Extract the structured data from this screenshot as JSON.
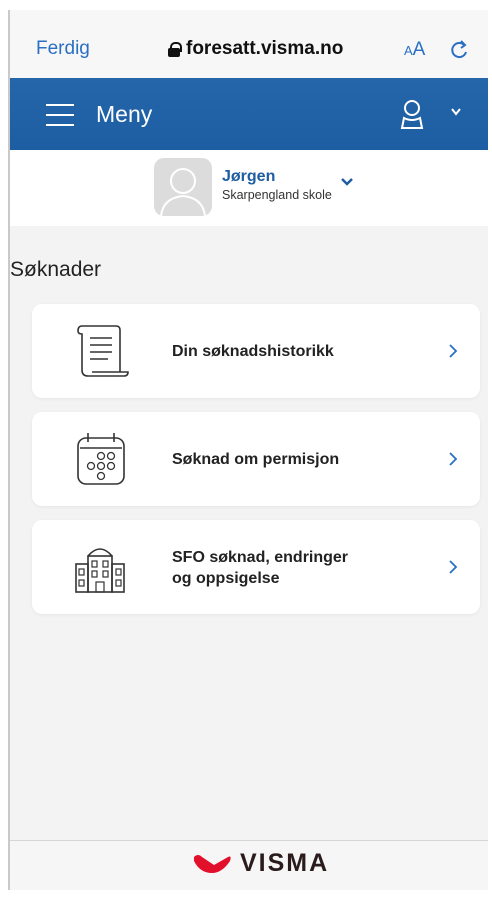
{
  "browser": {
    "done_label": "Ferdig",
    "url": "foresatt.visma.no",
    "text_size_label_small": "A",
    "text_size_label_large": "A"
  },
  "menu": {
    "label": "Meny"
  },
  "profile": {
    "name": "Jørgen",
    "school": "Skarpengland skole"
  },
  "section": {
    "title": "Søknader"
  },
  "cards": [
    {
      "label": "Din søknadshistorikk",
      "icon": "scroll-icon"
    },
    {
      "label": "Søknad om permisjon",
      "icon": "calendar-icon"
    },
    {
      "label": "SFO søknad, endringer\nog oppsigelse",
      "icon": "school-building-icon"
    }
  ],
  "footer": {
    "brand": "VISMA"
  },
  "colors": {
    "accent": "#1d5ea3",
    "link": "#2a6fc4",
    "brand_red": "#e3102c"
  }
}
